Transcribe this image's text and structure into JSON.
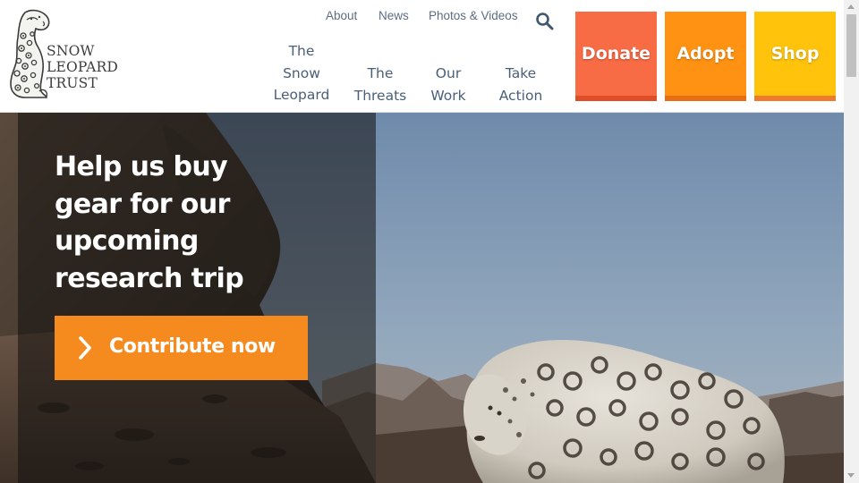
{
  "brand": {
    "line1": "SNOW",
    "line2": "LEOPARD",
    "line3": "TRUST"
  },
  "utility_nav": [
    {
      "label": "About"
    },
    {
      "label": "News"
    },
    {
      "label": "Photos & Videos"
    }
  ],
  "search": {
    "icon": "search-icon"
  },
  "main_nav": [
    {
      "lines": [
        "The",
        "Snow",
        "Leopard"
      ]
    },
    {
      "lines": [
        "The",
        "Threats"
      ]
    },
    {
      "lines": [
        "Our",
        "Work"
      ]
    },
    {
      "lines": [
        "Take",
        "Action"
      ]
    }
  ],
  "cta": [
    {
      "label": "Donate",
      "color": "#f76b45",
      "stripe": "#de4d26"
    },
    {
      "label": "Adopt",
      "color": "#ff9212",
      "stripe": "#e86e16"
    },
    {
      "label": "Shop",
      "color": "#ffc30c",
      "stripe": "#f07a2c"
    }
  ],
  "hero": {
    "headline": [
      "Help us buy",
      "gear for our",
      "upcoming",
      "research trip"
    ],
    "button_label": "Contribute now",
    "button_icon": "chevron-right-icon",
    "button_color": "#f58a1f"
  },
  "colors": {
    "nav_text": "#4a5f78",
    "util_text": "#5b6d82",
    "white": "#ffffff"
  }
}
